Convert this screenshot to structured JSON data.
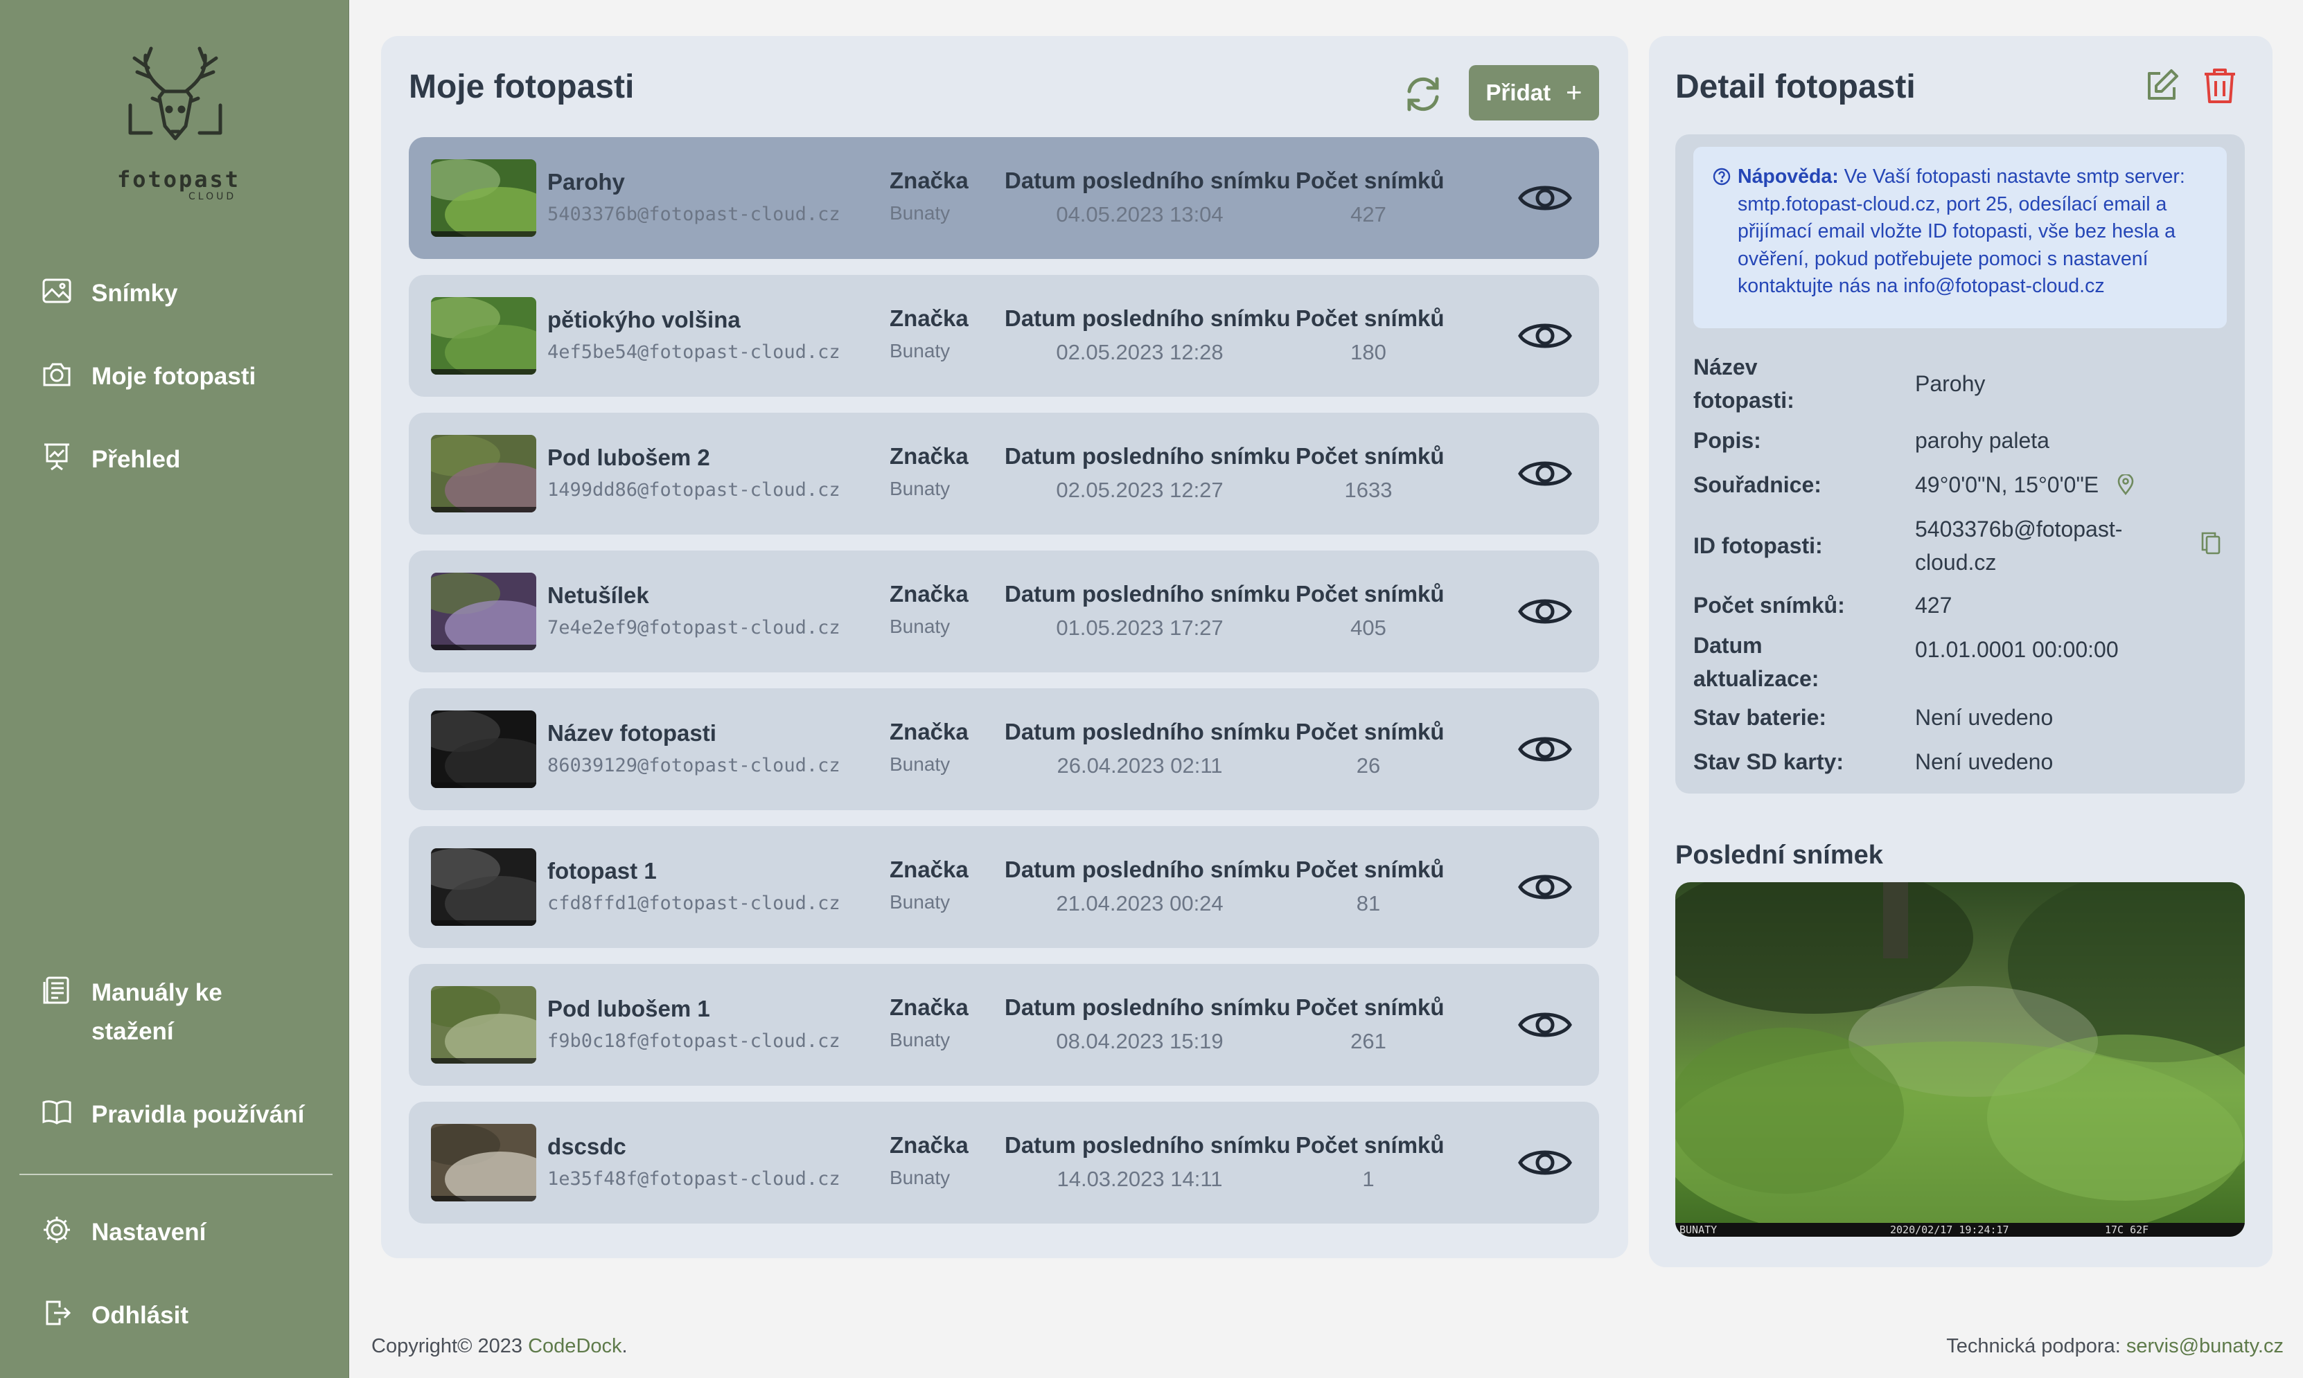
{
  "sidebar": {
    "logo_text": "fotopast",
    "logo_sub": "CLOUD",
    "items": [
      {
        "label": "Snímky"
      },
      {
        "label": "Moje fotopasti"
      },
      {
        "label": "Přehled"
      },
      {
        "label": "Manuály ke stažení"
      },
      {
        "label": "Pravidla používání"
      },
      {
        "label": "Nastavení"
      },
      {
        "label": "Odhlásit"
      }
    ]
  },
  "list": {
    "title": "Moje fotopasti",
    "add_label": "Přidat",
    "col_brand": "Značka",
    "col_date": "Datum posledního snímku",
    "col_count": "Počet snímků",
    "rows": [
      {
        "name": "Parohy",
        "email": "5403376b@fotopast-cloud.cz",
        "brand": "Bunaty",
        "date": "04.05.2023 13:04",
        "count": "427"
      },
      {
        "name": "pětiokýho volšina",
        "email": "4ef5be54@fotopast-cloud.cz",
        "brand": "Bunaty",
        "date": "02.05.2023 12:28",
        "count": "180"
      },
      {
        "name": "Pod lubošem 2",
        "email": "1499dd86@fotopast-cloud.cz",
        "brand": "Bunaty",
        "date": "02.05.2023 12:27",
        "count": "1633"
      },
      {
        "name": "Netušílek",
        "email": "7e4e2ef9@fotopast-cloud.cz",
        "brand": "Bunaty",
        "date": "01.05.2023 17:27",
        "count": "405"
      },
      {
        "name": "Název fotopasti",
        "email": "86039129@fotopast-cloud.cz",
        "brand": "Bunaty",
        "date": "26.04.2023 02:11",
        "count": "26"
      },
      {
        "name": "fotopast 1",
        "email": "cfd8ffd1@fotopast-cloud.cz",
        "brand": "Bunaty",
        "date": "21.04.2023 00:24",
        "count": "81"
      },
      {
        "name": "Pod lubošem 1",
        "email": "f9b0c18f@fotopast-cloud.cz",
        "brand": "Bunaty",
        "date": "08.04.2023 15:19",
        "count": "261"
      },
      {
        "name": "dscsdc",
        "email": "1e35f48f@fotopast-cloud.cz",
        "brand": "Bunaty",
        "date": "14.03.2023 14:11",
        "count": "1"
      }
    ]
  },
  "detail": {
    "title": "Detail fotopasti",
    "help_label": "Nápověda:",
    "help_text": " Ve Vaší fotopasti nastavte smtp server: smtp.fotopast-cloud.cz, port 25, odesílací email a přijímací email vložte ID fotopasti, vše bez hesla a ověření, pokud potřebujete pomoci s nastavení kontaktujte nás na info@fotopast-cloud.cz",
    "fields": {
      "name_label_1": "Název",
      "name_label_2": "fotopasti:",
      "name_value": "Parohy",
      "desc_label": "Popis:",
      "desc_value": "parohy paleta",
      "coords_label": "Souřadnice:",
      "coords_value": "49°0'0\"N, 15°0'0\"E",
      "id_label": "ID fotopasti:",
      "id_value_1": "5403376b@fotopast-",
      "id_value_2": "cloud.cz",
      "count_label": "Počet snímků:",
      "count_value": "427",
      "updated_label_1": "Datum",
      "updated_label_2": "aktualizace:",
      "updated_value": "01.01.0001 00:00:00",
      "battery_label": "Stav baterie:",
      "battery_value": "Není uvedeno",
      "sd_label": "Stav SD karty:",
      "sd_value": "Není uvedeno"
    },
    "last_image_title": "Poslední snímek",
    "stamp_left": "BUNATY",
    "stamp_mid": "2020/02/17 19:24:17",
    "stamp_right": "17C 62F"
  },
  "footer": {
    "copyright_prefix": "Copyright© 2023 ",
    "copyright_link": "CodeDock",
    "copyright_suffix": ".",
    "support_prefix": "Technická podpora: ",
    "support_link": "servis@bunaty.cz"
  },
  "colors": {
    "sidebar": "#7b8f6e",
    "panel": "#e4e9f0",
    "row": "#cfd7e1",
    "row_selected": "#98a6bb",
    "delete": "#e0413b",
    "help_text": "#2546b6"
  }
}
